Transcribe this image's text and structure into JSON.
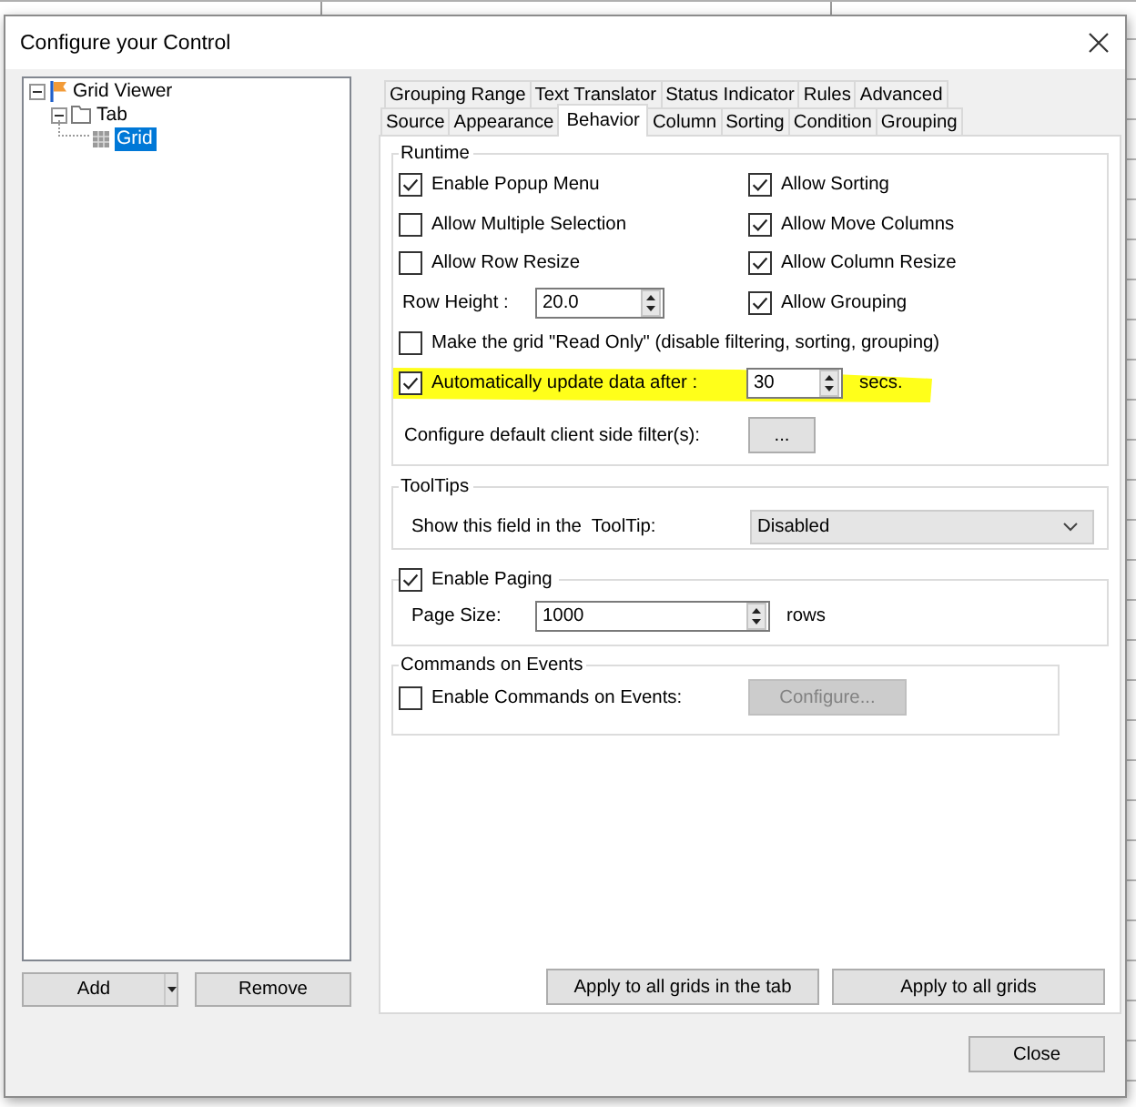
{
  "window": {
    "title": "Configure your Control"
  },
  "tree": [
    {
      "label": "Grid Viewer",
      "kind": "viewer",
      "expanded": true,
      "selected": false,
      "children": [
        {
          "label": "Tab",
          "kind": "folder",
          "expanded": true,
          "selected": false,
          "children": [
            {
              "label": "Grid",
              "kind": "grid",
              "selected": true
            }
          ]
        }
      ]
    }
  ],
  "tree_buttons": [
    {
      "label": "Add",
      "kind": "split"
    },
    {
      "label": "Remove",
      "kind": "plain"
    }
  ],
  "tab_rows": [
    [
      {
        "label": "Grouping Range",
        "selected": false
      },
      {
        "label": "Text Translator",
        "selected": false
      },
      {
        "label": "Status Indicator",
        "selected": false
      },
      {
        "label": "Rules",
        "selected": false
      },
      {
        "label": "Advanced",
        "selected": false
      }
    ],
    [
      {
        "label": "Source",
        "selected": false
      },
      {
        "label": "Appearance",
        "selected": false
      },
      {
        "label": "Behavior",
        "selected": true
      },
      {
        "label": "Column",
        "selected": false
      },
      {
        "label": "Sorting",
        "selected": false
      },
      {
        "label": "Condition",
        "selected": false
      },
      {
        "label": "Grouping",
        "selected": false
      }
    ]
  ],
  "runtime": {
    "title": "Runtime",
    "left": [
      {
        "kind": "checkbox",
        "label": "Enable Popup Menu",
        "checked": true
      },
      {
        "kind": "checkbox",
        "label": "Allow Multiple Selection",
        "checked": false
      },
      {
        "kind": "checkbox",
        "label": "Allow Row Resize",
        "checked": false
      },
      {
        "kind": "spinner",
        "label": "Row Height :",
        "value": "20.0"
      }
    ],
    "right": [
      {
        "kind": "checkbox",
        "label": "Allow Sorting",
        "checked": true
      },
      {
        "kind": "checkbox",
        "label": "Allow Move Columns",
        "checked": true
      },
      {
        "kind": "checkbox",
        "label": "Allow Column Resize",
        "checked": true
      },
      {
        "kind": "checkbox",
        "label": "Allow Grouping",
        "checked": true
      }
    ],
    "options": [
      {
        "kind": "checkbox",
        "label": "Make the grid \"Read Only\" (disable filtering, sorting, grouping)",
        "checked": false,
        "highlighted": false
      },
      {
        "kind": "checkbox_spinner",
        "label": "Automatically update data after :",
        "checked": true,
        "highlighted": true,
        "value": "30",
        "unit": "secs."
      },
      {
        "kind": "button",
        "label": "Configure default client side filter(s):",
        "button": "...",
        "highlighted": false
      }
    ]
  },
  "tooltips": {
    "title": "ToolTips",
    "label": "Show this field in the  ToolTip:",
    "value": "Disabled"
  },
  "paging": {
    "label": "Enable Paging",
    "checked": true,
    "field_label": "Page Size:",
    "value": "1000",
    "unit": "rows"
  },
  "commands": {
    "title": "Commands on Events",
    "label": "Enable Commands on Events:",
    "checked": false,
    "button": {
      "label": "Configure...",
      "disabled": true
    }
  },
  "panel_buttons": [
    {
      "label": "Apply to all grids in the tab"
    },
    {
      "label": "Apply to all grids"
    }
  ],
  "footer_buttons": [
    {
      "label": "Close"
    }
  ]
}
